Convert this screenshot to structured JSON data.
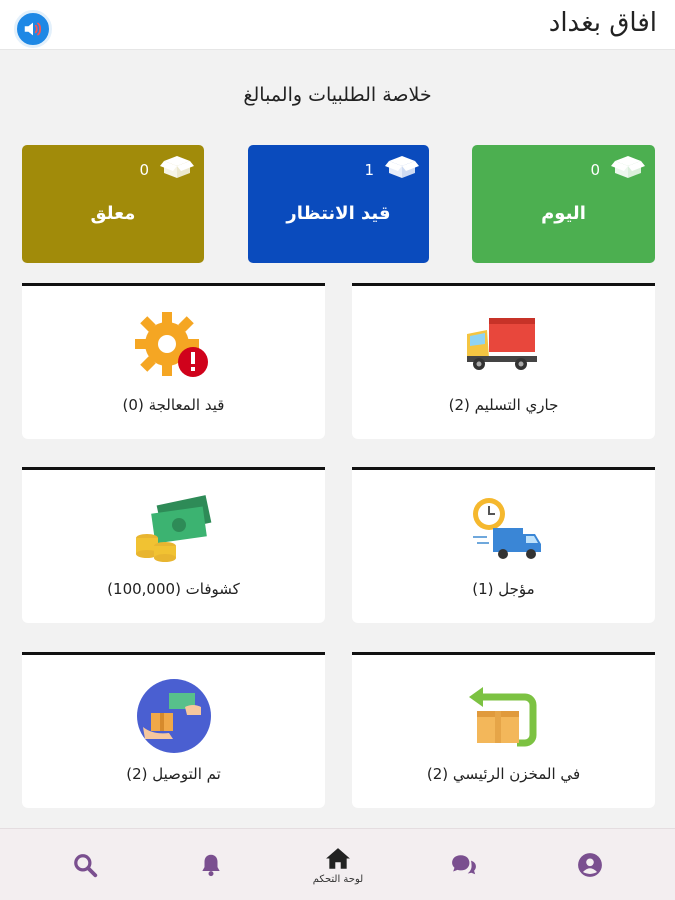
{
  "header": {
    "title": "افاق بغداد",
    "speaker_icon": "speaker-icon"
  },
  "summary": {
    "title": "خلاصة الطلبيات والمبالغ",
    "cards": [
      {
        "label": "اليوم",
        "count": "0",
        "color": "#4caf50",
        "icon": "box-icon"
      },
      {
        "label": "قيد الانتظار",
        "count": "1",
        "color": "#0a4bbd",
        "icon": "box-icon"
      },
      {
        "label": "معلق",
        "count": "0",
        "color": "#a18b0a",
        "icon": "box-icon"
      }
    ]
  },
  "tiles": [
    {
      "label": "جاري التسليم (2)",
      "icon": "delivery-truck-icon"
    },
    {
      "label": "قيد المعالجة (0)",
      "icon": "gear-alert-icon"
    },
    {
      "label": "مؤجل (1)",
      "icon": "delayed-truck-clock-icon"
    },
    {
      "label": "كشوفات (100,000)",
      "icon": "money-coins-icon"
    },
    {
      "label": "في المخزن الرئيسي (2)",
      "icon": "warehouse-return-box-icon"
    },
    {
      "label": "تم التوصيل (2)",
      "icon": "hand-delivery-icon"
    }
  ],
  "bottom_nav": {
    "items": [
      {
        "name": "profile",
        "icon": "user-circle-icon",
        "label": ""
      },
      {
        "name": "chat",
        "icon": "chat-bubbles-icon",
        "label": ""
      },
      {
        "name": "home",
        "icon": "home-icon",
        "label": "لوحة التحكم"
      },
      {
        "name": "notifications",
        "icon": "bell-icon",
        "label": ""
      },
      {
        "name": "search",
        "icon": "search-icon",
        "label": ""
      }
    ],
    "icon_color": "#7a4f8f"
  }
}
